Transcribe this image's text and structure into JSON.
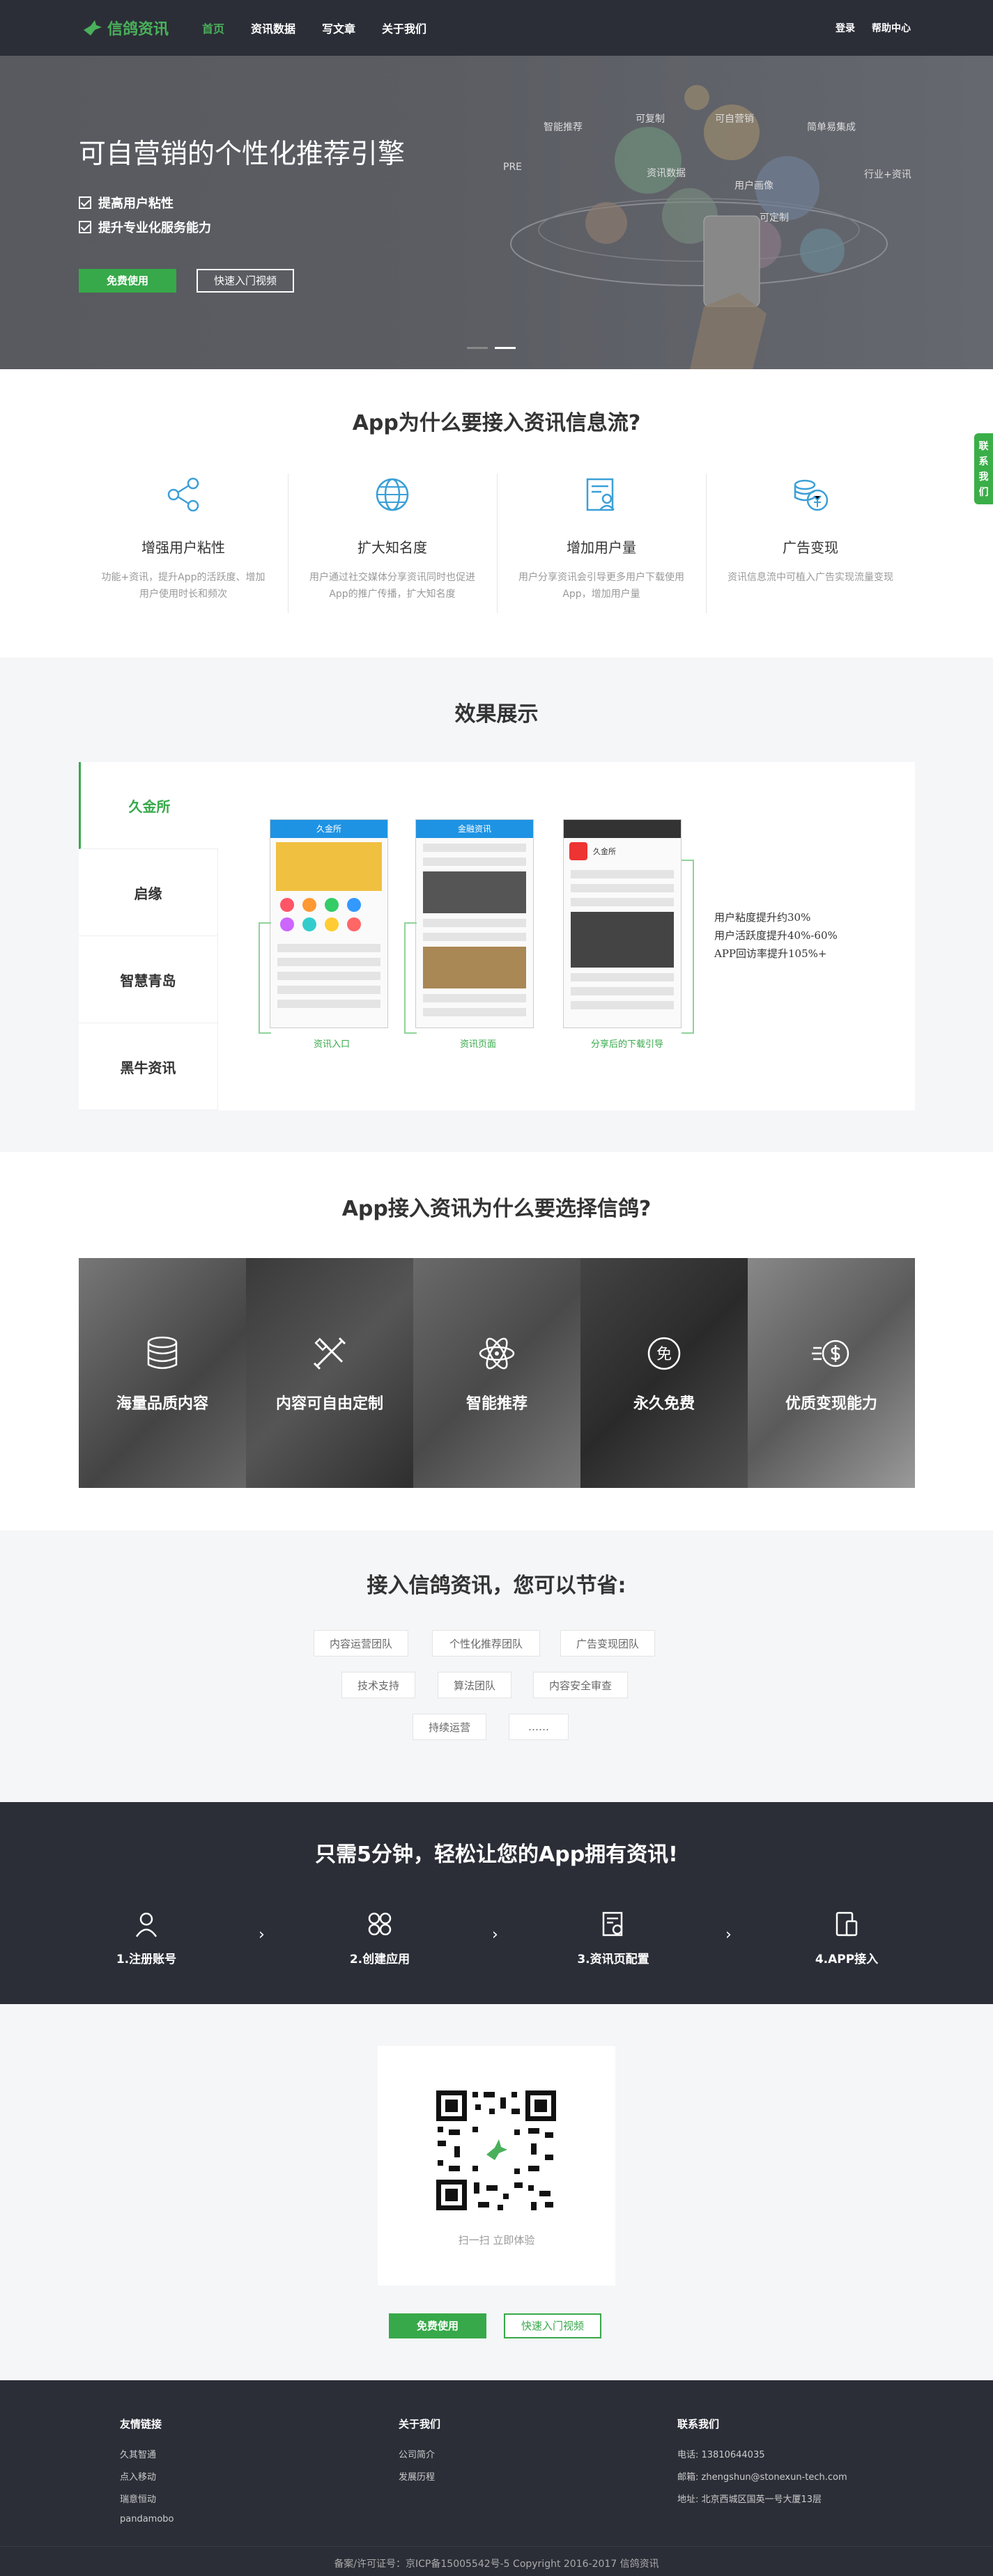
{
  "header": {
    "logo_text": "信鸽资讯",
    "nav": [
      "首页",
      "资讯数据",
      "写文章",
      "关于我们"
    ],
    "login": "登录",
    "help": "帮助中心",
    "accent": "#4ab05a"
  },
  "hero": {
    "title": "可自营销的个性化推荐引擎",
    "checks": [
      "提高用户粘性",
      "提升专业化服务能力"
    ],
    "btn_free": "免费使用",
    "btn_guide": "快速入门视频",
    "bubbles": [
      "智能推荐",
      "可复制",
      "可自营销",
      "简单易集成",
      "PRE",
      "行业+资讯",
      "资讯数据",
      "用户画像",
      "可定制"
    ]
  },
  "contact_tab": "联系我们",
  "why": {
    "title": "App为什么要接入资讯信息流?",
    "items": [
      {
        "title": "增强用户粘性",
        "desc": "功能+资讯，提升App的活跃度、增加用户使用时长和频次",
        "icon": "share-icon"
      },
      {
        "title": "扩大知名度",
        "desc": "用户通过社交媒体分享资讯同时也促进App的推广传播，扩大知名度",
        "icon": "globe-icon"
      },
      {
        "title": "增加用户量",
        "desc": "用户分享资讯会引导更多用户下载使用App，增加用户量",
        "icon": "user-card-icon"
      },
      {
        "title": "广告变现",
        "desc": "资讯信息流中可植入广告实现流量变现",
        "icon": "coin-icon"
      }
    ]
  },
  "effect": {
    "title": "效果展示",
    "tabs": [
      "久金所",
      "启缘",
      "智慧青岛",
      "黑牛资讯"
    ],
    "captions": [
      "资讯入口",
      "资讯页面",
      "分享后的下载引导"
    ],
    "stats": [
      "用户粘度提升约30%",
      "用户活跃度提升40%-60%",
      "APP回访率提升105%+"
    ],
    "phone1_brand": "久金所",
    "phone2_brand": "金融资讯",
    "phone3_brand": "久金所"
  },
  "choose": {
    "title": "App接入资讯为什么要选择信鸽?",
    "cards": [
      {
        "label": "海量品质内容",
        "icon": "database-icon"
      },
      {
        "label": "内容可自由定制",
        "icon": "tools-icon"
      },
      {
        "label": "智能推荐",
        "icon": "atom-icon"
      },
      {
        "label": "永久免费",
        "icon": "free-badge-icon"
      },
      {
        "label": "优质变现能力",
        "icon": "dollar-icon"
      }
    ],
    "free_glyph": "免"
  },
  "save": {
    "title": "接入信鸽资讯，您可以节省:",
    "pills": [
      "内容运营团队",
      "个性化推荐团队",
      "广告变现团队",
      "技术支持",
      "算法团队",
      "内容安全审查",
      "持续运营",
      "……"
    ]
  },
  "steps": {
    "title": "只需5分钟，轻松让您的App拥有资讯!",
    "items": [
      "1.注册账号",
      "2.创建应用",
      "3.资讯页配置",
      "4.APP接入"
    ],
    "arrow": "›"
  },
  "qr": {
    "tip": "扫一扫 立即体验",
    "btn_free": "免费使用",
    "btn_guide": "快速入门视频"
  },
  "footer": {
    "col1": {
      "title": "友情链接",
      "links": [
        "久其智通",
        "点入移动",
        "瑞意恒动",
        "pandamobo"
      ]
    },
    "col2": {
      "title": "关于我们",
      "links": [
        "公司简介",
        "发展历程"
      ]
    },
    "col3": {
      "title": "联系我们",
      "lines": [
        "电话: 13810644035",
        "邮箱: zhengshun@stonexun-tech.com",
        "地址: 北京西城区国英一号大厦13层"
      ]
    },
    "copyright": "备案/许可证号：京ICP备15005542号-5 Copyright 2016-2017 信鸽资讯"
  }
}
